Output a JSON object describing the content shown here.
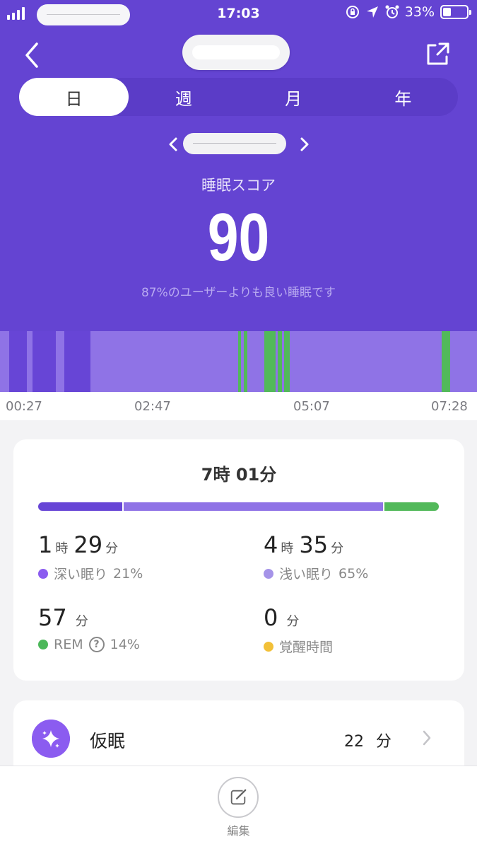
{
  "status_bar": {
    "time": "17:03",
    "battery": "33%",
    "battery_level": 0.33
  },
  "header": {
    "tabs": [
      "日",
      "週",
      "月",
      "年"
    ],
    "active_tab": 0
  },
  "score": {
    "label": "睡眠スコア",
    "value": "90",
    "comparison": "87%のユーザーよりも良い睡眠です"
  },
  "chart_data": {
    "type": "timeline",
    "x_ticks": [
      "00:27",
      "02:47",
      "05:07",
      "07:28"
    ],
    "x_range": [
      "00:27",
      "07:28"
    ],
    "stages": [
      {
        "stage": "浅い眠り",
        "start": "00:27",
        "end": "00:35"
      },
      {
        "stage": "深い眠り",
        "start": "00:35",
        "end": "00:51"
      },
      {
        "stage": "浅い眠り",
        "start": "00:51",
        "end": "00:56"
      },
      {
        "stage": "深い眠り",
        "start": "00:56",
        "end": "01:16"
      },
      {
        "stage": "浅い眠り",
        "start": "01:16",
        "end": "01:24"
      },
      {
        "stage": "深い眠り",
        "start": "01:24",
        "end": "01:47"
      },
      {
        "stage": "浅い眠り",
        "start": "01:47",
        "end": "03:57"
      },
      {
        "stage": "REM",
        "start": "03:57",
        "end": "04:00"
      },
      {
        "stage": "浅い眠り",
        "start": "04:00",
        "end": "04:02"
      },
      {
        "stage": "REM",
        "start": "04:02",
        "end": "04:05"
      },
      {
        "stage": "浅い眠り",
        "start": "04:05",
        "end": "04:20"
      },
      {
        "stage": "REM",
        "start": "04:20",
        "end": "04:30"
      },
      {
        "stage": "浅い眠り",
        "start": "04:30",
        "end": "04:32"
      },
      {
        "stage": "REM",
        "start": "04:32",
        "end": "04:36"
      },
      {
        "stage": "浅い眠り",
        "start": "04:36",
        "end": "04:38"
      },
      {
        "stage": "REM",
        "start": "04:38",
        "end": "04:43"
      },
      {
        "stage": "浅い眠り",
        "start": "04:43",
        "end": "06:57"
      },
      {
        "stage": "REM",
        "start": "06:57",
        "end": "07:04"
      },
      {
        "stage": "浅い眠り",
        "start": "07:04",
        "end": "07:28"
      }
    ],
    "colors": {
      "深い眠り": "#6745d6",
      "浅い眠り": "#8f73e6",
      "REM": "#52b95a"
    }
  },
  "summary": {
    "total_hours": "7",
    "total_hours_unit": "時",
    "total_minutes": "01",
    "total_minutes_unit": "分",
    "distribution": [
      {
        "name": "deep",
        "percent": 21,
        "color": "#6745d6"
      },
      {
        "name": "light",
        "percent": 65,
        "color": "#8f73e6"
      },
      {
        "name": "rem",
        "percent": 14,
        "color": "#52b95a"
      }
    ],
    "deep": {
      "hours": "1",
      "h_unit": "時",
      "minutes": "29",
      "m_unit": "分",
      "label": "深い眠り",
      "percent": "21%",
      "color": "#8b5cf0"
    },
    "light": {
      "hours": "4",
      "h_unit": "時",
      "minutes": "35",
      "m_unit": "分",
      "label": "浅い眠り",
      "percent": "65%",
      "color": "#a593e8"
    },
    "rem": {
      "minutes": "57",
      "m_unit": "分",
      "label": "REM",
      "help_icon": "?",
      "percent": "14%",
      "color": "#4cb85a"
    },
    "awake": {
      "minutes": "0",
      "m_unit": "分",
      "label": "覚醒時間",
      "color": "#f2c038"
    }
  },
  "nap": {
    "label": "仮眠",
    "value": "22",
    "unit": "分",
    "icon": "sparkle-icon"
  },
  "bottom": {
    "edit_label": "編集",
    "edit_icon": "edit-icon"
  }
}
